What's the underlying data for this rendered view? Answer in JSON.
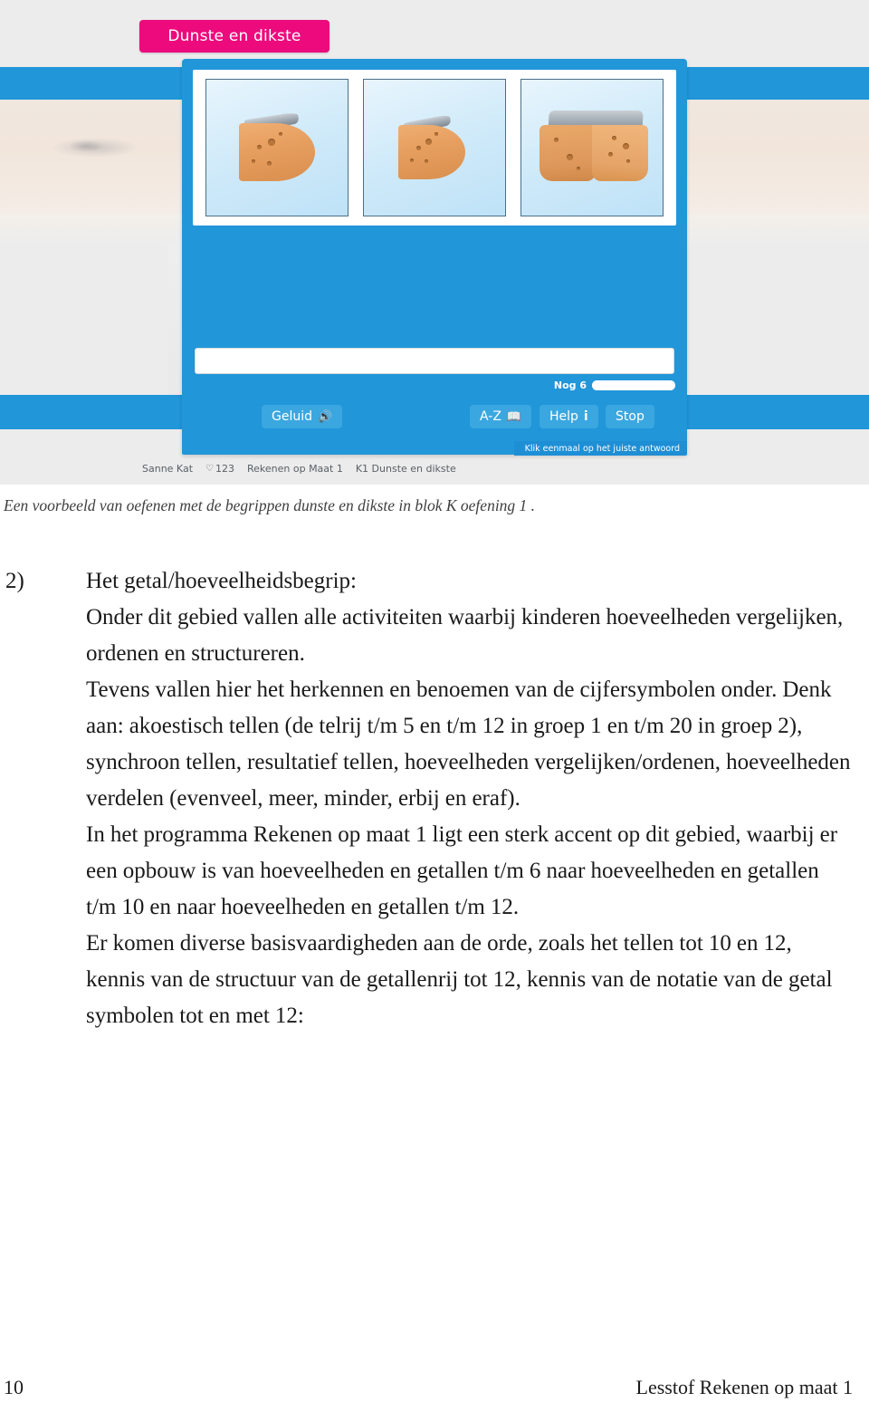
{
  "figure": {
    "lesson_chip": "Dunste en dikste",
    "exercise_images": [
      {
        "alt": "cheese-wedge-thin"
      },
      {
        "alt": "cheese-wedge-thinner"
      },
      {
        "alt": "cheese-block-thick"
      }
    ],
    "answer_field_value": "",
    "progress_label": "Nog 6",
    "buttons": {
      "sound": "Geluid",
      "sound_icon": "speaker-icon",
      "az": "A-Z",
      "az_icon": "book-icon",
      "help": "Help",
      "help_icon": "info-i-icon",
      "stop": "Stop"
    },
    "hint": "Klik eenmaal op het juiste antwoord",
    "status": {
      "pupil": "Sanne Kat",
      "hearts_icon": "heart-icon",
      "score": "123",
      "program": "Rekenen op Maat 1",
      "block": "K1 Dunste en dikste"
    },
    "colors": {
      "panel_blue": "#2196d9",
      "button_blue": "#3aa7e0",
      "chip_pink": "#ec0a7d",
      "page_grey": "#ececec"
    }
  },
  "caption": "Een voorbeeld van oefenen met de begrippen dunste en dikste in blok K oefening 1 .",
  "body": {
    "marker": "2)",
    "paragraphs": [
      "Het getal/hoeveelheidsbegrip:",
      "Onder dit gebied vallen alle activiteiten waarbij kinderen hoeveelheden vergelijken, ordenen en structureren.",
      "Tevens vallen hier het herkennen en benoemen van de cijfersymbolen onder. Denk aan: akoestisch tellen (de telrij t/m 5 en t/m 12 in groep 1 en t/m 20 in groep 2), synchroon tellen, resultatief tellen, hoeveelheden vergelijken/ordenen, hoeveelheden verdelen (evenveel, meer, minder, erbij en eraf).",
      "In het programma  Rekenen op maat 1 ligt een sterk accent op dit gebied, waarbij er een opbouw is van hoeveelheden en getallen t/m 6 naar hoeveelheden en getallen t/m 10 en naar hoeveelheden en getallen t/m 12.",
      "Er komen diverse basisvaardigheden aan de orde, zoals het tellen tot 10 en 12, kennis van de structuur van de getallenrij tot 12, kennis van de notatie van de getal symbolen tot en met 12:"
    ]
  },
  "footer": {
    "page_number": "10",
    "title": "Lesstof Rekenen op maat 1"
  }
}
